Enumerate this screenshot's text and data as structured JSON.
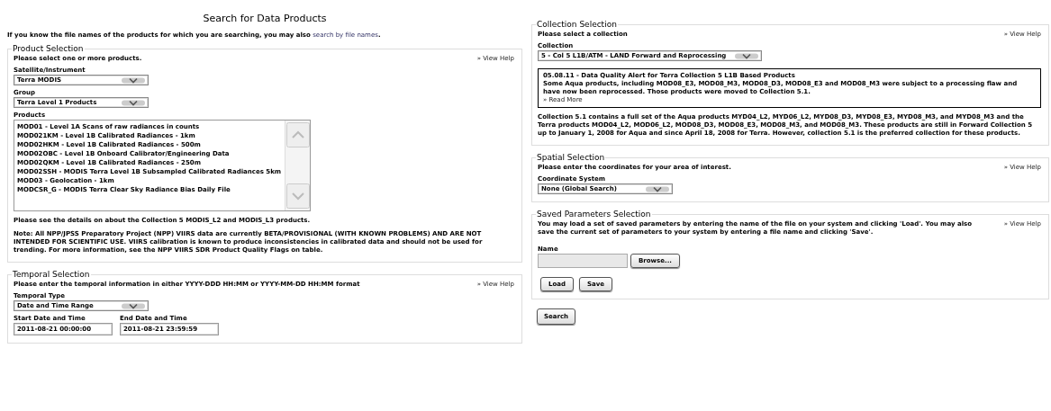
{
  "title": "Search for Data Products",
  "intro": {
    "text": "If you know the file names of the products for which you are searching, you may also",
    "link": "search by file names",
    "after": "."
  },
  "left_sections": [
    {
      "legend": "Product Selection",
      "instruction": "Please select one or more products.",
      "help": "» View Help",
      "blocks": [
        {
          "kind": "select",
          "label": "Satellite/Instrument",
          "value": "Terra MODIS"
        },
        {
          "kind": "select",
          "label": "Group",
          "value": "Terra Level 1 Products"
        },
        {
          "kind": "listbox",
          "label": "Products",
          "items": [
            "MOD01 - Level 1A Scans of raw radiances in counts",
            "MOD021KM - Level 1B Calibrated Radiances - 1km",
            "MOD02HKM - Level 1B Calibrated Radiances - 500m",
            "MOD02OBC - Level 1B Onboard Calibrator/Engineering Data",
            "MOD02QKM - Level 1B Calibrated Radiances - 250m",
            "MOD02SSH - MODIS Terra Level 1B Subsampled Calibrated Radiances 5km",
            "MOD03 - Geolocation - 1km",
            "MODCSR_G - MODIS Terra Clear Sky Radiance Bias Daily File"
          ]
        },
        {
          "kind": "note",
          "text": "Please see the details on about the Collection 5 MODIS_L2 and MODIS_L3 products."
        },
        {
          "kind": "note",
          "text": "Note: All NPP/JPSS Preparatory Project (NPP) VIIRS data are currently BETA/PROVISIONAL (WITH KNOWN PROBLEMS) AND ARE NOT INTENDED FOR SCIENTIFIC USE. VIIRS calibration is known to produce inconsistencies in calibrated data and should not be used for trending. For more information, see the NPP VIIRS SDR Product Quality Flags on table."
        }
      ]
    },
    {
      "legend": "Temporal Selection",
      "instruction": "Please enter the temporal information in either YYYY-DDD HH:MM or YYYY-MM-DD HH:MM format",
      "help": "» View Help",
      "blocks": [
        {
          "kind": "select",
          "label": "Temporal Type",
          "value": "Date and Time Range"
        },
        {
          "kind": "inputs",
          "fields": [
            {
              "label": "Start Date and Time",
              "value": "2011-08-21 00:00:00"
            },
            {
              "label": "End Date and Time",
              "value": "2011-08-21 23:59:59"
            }
          ]
        }
      ]
    }
  ],
  "right_sections": [
    {
      "legend": "Collection Selection",
      "instruction": "Please select a collection",
      "help": "» View Help",
      "blocks": [
        {
          "kind": "select",
          "label": "Collection",
          "value": "5 - Col 5 L1B/ATM - LAND Forward and Reprocessing"
        },
        {
          "kind": "notice",
          "title": "05.08.11 - Data Quality Alert for Terra Collection 5 L1B Based Products",
          "text": "Some Aqua products, including MOD08_E3, MOD08_M3, MOD08_D3, MOD08_E3 and MOD08_M3 were subject to a processing flaw and have now been reprocessed. Those products were moved to Collection 5.1.",
          "link": "» Read More"
        },
        {
          "kind": "note",
          "text": "Collection 5.1 contains a full set of the Aqua products MYD04_L2, MYD06_L2, MYD08_D3, MYD08_E3, MYD08_M3, and MYD08_M3 and the Terra products MOD04_L2, MOD06_L2, MOD08_D3, MOD08_E3, MOD08_M3, and MOD08_M3. These products are still in Forward Collection 5 up to January 1, 2008 for Aqua and since April 18, 2008 for Terra. However, collection 5.1 is the preferred collection for these products."
        }
      ]
    },
    {
      "legend": "Spatial Selection",
      "instruction": "Please enter the coordinates for your area of interest.",
      "help": "» View Help",
      "blocks": [
        {
          "kind": "select",
          "label": "Coordinate System",
          "value": "None (Global Search)"
        }
      ]
    },
    {
      "legend": "Saved Parameters Selection",
      "instruction": "You may load a set of saved parameters by entering the name of the file on your system and clicking 'Load'. You may also save the current set of parameters to your system by entering a file name and clicking 'Save'.",
      "help": "» View Help",
      "blocks": [
        {
          "kind": "file",
          "label": "Name",
          "button": "Browse..."
        },
        {
          "kind": "buttons",
          "items": [
            "Load",
            "Save"
          ]
        }
      ]
    }
  ],
  "search_button": "Search"
}
